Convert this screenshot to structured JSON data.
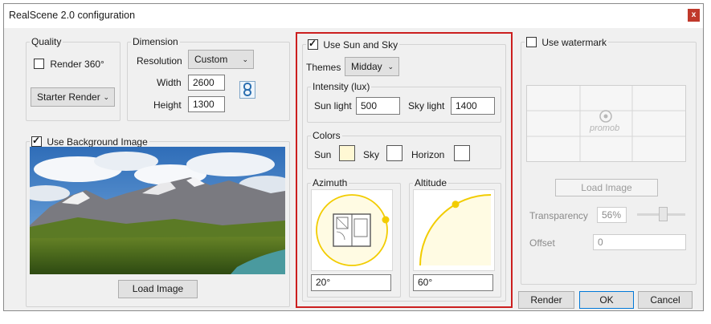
{
  "window": {
    "title": "RealScene 2.0 configuration",
    "close_glyph": "x"
  },
  "quality": {
    "legend": "Quality",
    "render360_label": "Render 360°",
    "render360_checked": false,
    "preset": "Starter Render"
  },
  "dimension": {
    "legend": "Dimension",
    "resolution_label": "Resolution",
    "resolution_value": "Custom",
    "width_label": "Width",
    "width_value": "2600",
    "height_label": "Height",
    "height_value": "1300"
  },
  "background": {
    "label": "Use Background Image",
    "checked": true,
    "load_button": "Load Image"
  },
  "sun_sky": {
    "label": "Use Sun and Sky",
    "checked": true,
    "themes_label": "Themes",
    "theme_value": "Midday",
    "intensity": {
      "legend": "Intensity (lux)",
      "sun_label": "Sun light",
      "sun_value": "500",
      "sky_label": "Sky light",
      "sky_value": "1400"
    },
    "colors": {
      "legend": "Colors",
      "sun_label": "Sun",
      "sun_color": "#fff8d4",
      "sky_label": "Sky",
      "sky_color": "#ffffff",
      "horizon_label": "Horizon",
      "horizon_color": "#ffffff"
    },
    "azimuth": {
      "legend": "Azimuth",
      "value": "20°"
    },
    "altitude": {
      "legend": "Altitude",
      "value": "60°"
    },
    "highlight_color": "#cc1f1f",
    "sun_dot_color": "#f2cc00"
  },
  "watermark": {
    "label": "Use watermark",
    "checked": false,
    "logo_text": "promob",
    "load_button": "Load Image",
    "transparency_label": "Transparency",
    "transparency_value": "56%",
    "transparency_level": 0.56,
    "offset_label": "Offset",
    "offset_value": "0"
  },
  "footer": {
    "render": "Render",
    "ok": "OK",
    "cancel": "Cancel"
  }
}
